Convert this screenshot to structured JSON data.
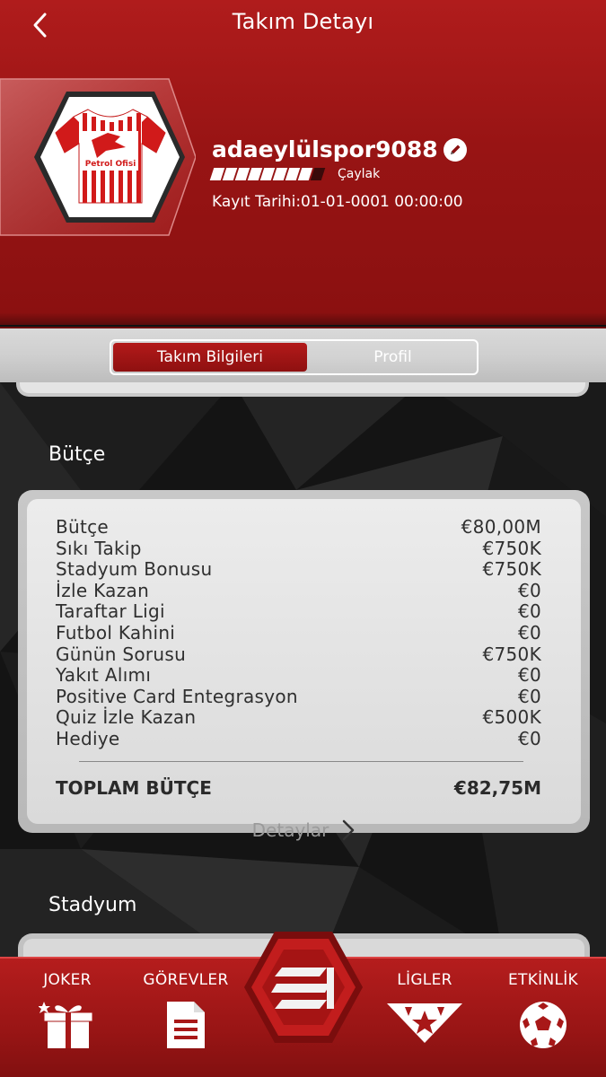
{
  "header": {
    "title": "Takım Detayı",
    "team_name": "adaeylülspor9088",
    "level_label": "Çaylak",
    "level_fill": 0.88,
    "registration": "Kayıt Tarihi:01-01-0001 00:00:00",
    "shirt_sponsor": "Petrol Ofisi"
  },
  "tabs": [
    {
      "label": "Takım Bilgileri",
      "active": true
    },
    {
      "label": "Profil",
      "active": false
    }
  ],
  "budget": {
    "section_title": "Bütçe",
    "rows": [
      {
        "label": "Bütçe",
        "value": "€80,00M"
      },
      {
        "label": "Sıkı Takip",
        "value": "€750K"
      },
      {
        "label": "Stadyum Bonusu",
        "value": "€750K"
      },
      {
        "label": "İzle Kazan",
        "value": "€0"
      },
      {
        "label": "Taraftar Ligi",
        "value": "€0"
      },
      {
        "label": "Futbol Kahini",
        "value": "€0"
      },
      {
        "label": "Günün Sorusu",
        "value": "€750K"
      },
      {
        "label": "Yakıt Alımı",
        "value": "€0"
      },
      {
        "label": "Positive Card Entegrasyon",
        "value": "€0"
      },
      {
        "label": "Quiz İzle Kazan",
        "value": "€500K"
      },
      {
        "label": "Hediye",
        "value": "€0"
      }
    ],
    "total_label": "TOPLAM BÜTÇE",
    "total_value": "€82,75M",
    "details_label": "Detaylar"
  },
  "stadium": {
    "section_title": "Stadyum"
  },
  "nav": {
    "joker": "JOKER",
    "tasks": "GÖREVLER",
    "leagues": "LİGLER",
    "events": "ETKİNLİK"
  },
  "colors": {
    "primary_red": "#a81818",
    "card_bg": "#e6e6e6",
    "text_dark": "#2f2f2f"
  }
}
